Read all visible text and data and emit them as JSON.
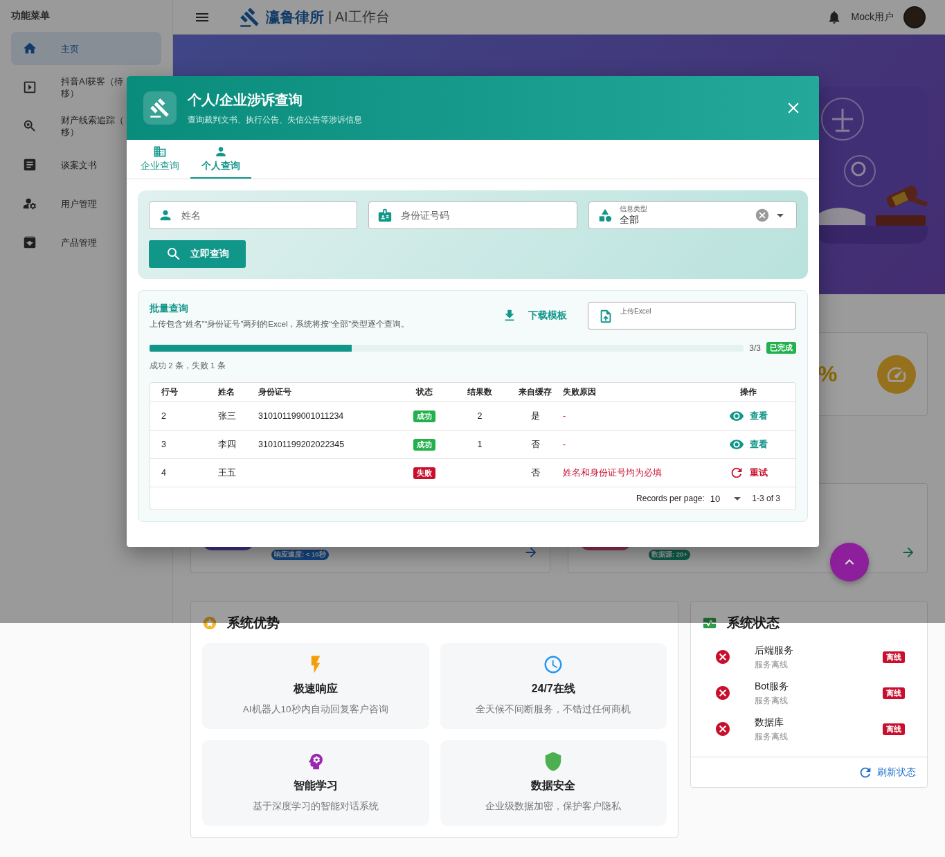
{
  "sidebar": {
    "title": "功能菜单",
    "items": [
      {
        "label": "主页",
        "selected": true
      },
      {
        "label": "抖音AI获客（待移）",
        "selected": false
      },
      {
        "label": "财产线索追踪（移）",
        "selected": false
      },
      {
        "label": "谈案文书",
        "selected": false
      },
      {
        "label": "用户管理",
        "selected": false
      },
      {
        "label": "产品管理",
        "selected": false
      }
    ]
  },
  "header": {
    "brand": "瀛鲁律所",
    "subtitle": "| AI工作台",
    "user": "Mock用户"
  },
  "stat_card": {
    "value": "%"
  },
  "feature_cards": [
    {
      "chip": "响应速度: < 10秒"
    },
    {
      "chip": "数据源: 20+"
    }
  ],
  "advantages": {
    "title": "系统优势",
    "items": [
      {
        "title": "极速响应",
        "text": "AI机器人10秒内自动回复客户咨询",
        "color": "#f59e0b"
      },
      {
        "title": "24/7在线",
        "text": "全天候不间断服务，不错过任何商机",
        "color": "#2196f3"
      },
      {
        "title": "智能学习",
        "text": "基于深度学习的智能对话系统",
        "color": "#9c27b0"
      },
      {
        "title": "数据安全",
        "text": "企业级数据加密，保护客户隐私",
        "color": "#4caf50"
      }
    ]
  },
  "system_status": {
    "title": "系统状态",
    "services": [
      {
        "name": "后端服务",
        "detail": "服务离线",
        "status": {
          "label": "离线",
          "kind": "offline"
        }
      },
      {
        "name": "Bot服务",
        "detail": "服务离线",
        "status": {
          "label": "离线",
          "kind": "offline"
        }
      },
      {
        "name": "数据库",
        "detail": "服务离线",
        "status": {
          "label": "离线",
          "kind": "offline"
        }
      }
    ],
    "refresh": "刷新状态"
  },
  "dialog": {
    "title": "个人/企业涉诉查询",
    "subtitle": "查询裁判文书、执行公告、失信公告等涉诉信息",
    "tabs": [
      {
        "label": "企业查询",
        "selected": false
      },
      {
        "label": "个人查询",
        "selected": true
      }
    ],
    "fields": [
      {
        "kind": "text",
        "placeholder": "姓名"
      },
      {
        "kind": "text",
        "placeholder": "身份证号码"
      },
      {
        "kind": "select",
        "label": "信息类型",
        "value": "全部"
      }
    ],
    "search_button": "立即查询",
    "batch": {
      "title": "批量查询",
      "hint": "上传包含“姓名”“身份证号”两列的Excel，系统将按“全部”类型逐个查询。",
      "download": "下载模板",
      "upload_label": "上传Excel",
      "progress": {
        "level": 0.34,
        "count": "3/3",
        "status": "已完成"
      },
      "summary": "成功 2 条，失败 1 条",
      "table": {
        "columns": [
          "行号",
          "姓名",
          "身份证号",
          "状态",
          "结果数",
          "来自缓存",
          "失败原因",
          "操作"
        ],
        "rows": [
          {
            "row": "2",
            "name": "张三",
            "id": "310101199001011234",
            "status": {
              "label": "成功",
              "kind": "success"
            },
            "results": "2",
            "cached": "是",
            "reason": "-",
            "action": {
              "label": "查看",
              "kind": "view"
            }
          },
          {
            "row": "3",
            "name": "李四",
            "id": "310101199202022345",
            "status": {
              "label": "成功",
              "kind": "success"
            },
            "results": "1",
            "cached": "否",
            "reason": "-",
            "action": {
              "label": "查看",
              "kind": "view"
            }
          },
          {
            "row": "4",
            "name": "王五",
            "status": {
              "label": "失败",
              "kind": "failed"
            },
            "cached": "否",
            "reason": "姓名和身份证号均为必填",
            "action": {
              "label": "重试",
              "kind": "retry"
            }
          }
        ]
      },
      "pagination": {
        "label": "Records per page:",
        "per_page": "10",
        "range": "1-3 of 3"
      }
    }
  }
}
